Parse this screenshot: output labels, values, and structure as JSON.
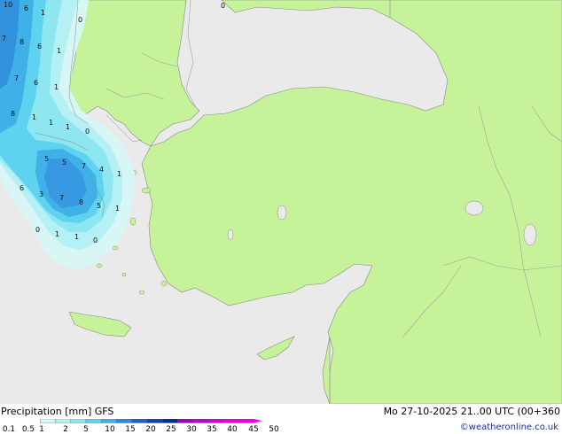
{
  "product": "Precipitation [mm]  GFS",
  "run": "Mo 27-10-2025 21..00 UTC (00+360",
  "credit": "©weatheronline.co.uk",
  "colors": {
    "sea": "#eaeaea",
    "land": "#c6f39a",
    "border": "#a0a0a0",
    "coast": "#888888"
  },
  "legend": {
    "labels": [
      "0.1",
      "0.5",
      "1",
      "2",
      "5",
      "10",
      "15",
      "20",
      "25",
      "30",
      "35",
      "40",
      "45",
      "50"
    ],
    "colors": [
      "#d8f7f7",
      "#b4f0f4",
      "#8ee6f0",
      "#5ed2ee",
      "#3fb0e8",
      "#2f87da",
      "#1f5fc8",
      "#1240ae",
      "#0a2a8a",
      "#a000c8",
      "#c000d8",
      "#d800e0",
      "#e800e8",
      "#f000f0"
    ]
  },
  "map_values": [
    "10",
    "6",
    "1",
    "7",
    "6",
    "8",
    "7",
    "6",
    "1",
    "8",
    "1",
    "1",
    "1",
    "0",
    "0",
    "5",
    "5",
    "7",
    "4",
    "1",
    "1",
    "6",
    "3",
    "7",
    "8",
    "5",
    "1",
    "0",
    "1",
    "1",
    "0",
    "0"
  ]
}
